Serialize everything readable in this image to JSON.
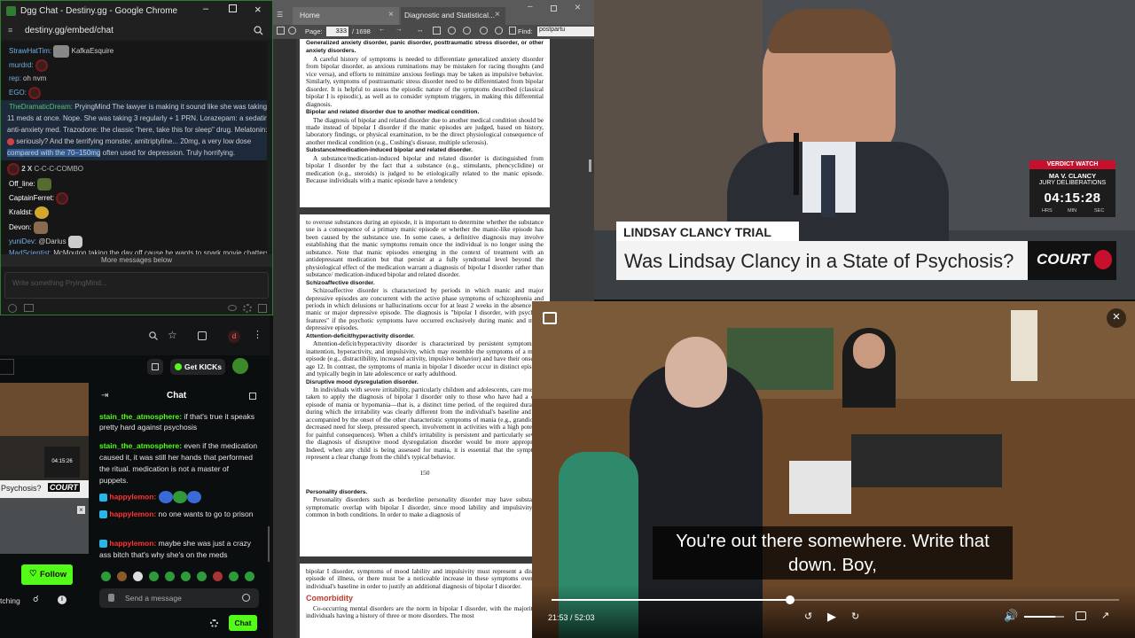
{
  "chrome": {
    "title": "Dgg Chat - Destiny.gg - Google Chrome",
    "url": "destiny.gg/embed/chat",
    "messages": [
      {
        "user": "StrawHatTim:",
        "text": "KafkaEsquire"
      },
      {
        "user": "murdrd:",
        "text": ""
      },
      {
        "user": "rep:",
        "text": "oh nvm"
      },
      {
        "user": "EGO:",
        "text": ""
      }
    ],
    "highlight": {
      "user": "TheDramaticDream:",
      "line1": "PryingMind The lawyer is making it sound like she was taking",
      "line2": "11 meds at once. Nope. She was taking 3 regularly + 1 PRN. Lorazepam: a sedating",
      "line3": "anti-anxiety med. Trazodone: the classic \"here, take this for sleep\" drug. Melatonin:",
      "line4": "seriously? And the terrifying monster, amitriptyline... 20mg, a very low dose",
      "line5a": "compared with the 70–150mg",
      "line5b": " often used for depression. Truly horrifying."
    },
    "combo": "2 X",
    "combo_text": "C-C-C-COMBO",
    "messages2": [
      {
        "user": "Off_line:",
        "text": ""
      },
      {
        "user": "CaptainFerret:",
        "text": ""
      },
      {
        "user": "Kraldst:",
        "text": ""
      },
      {
        "user": "Devon:",
        "text": ""
      },
      {
        "user": "yuniDev:",
        "text": "@Darius"
      },
      {
        "user": "MadScientist:",
        "text": "McMouton taking the day off cause he wants to spark movie chatters"
      }
    ],
    "more_below": "More messages below",
    "input_placeholder": "Write something PryingMind..."
  },
  "kick": {
    "avatar_letter": "d",
    "get_kicks": "Get KICKs",
    "chat_title": "Chat",
    "mini_time": "04:15:26",
    "mini_banner": "Psychosis?",
    "mini_logo": "COURT",
    "follow": "Follow",
    "watching": "tching",
    "messages": [
      {
        "user": "stain_the_atmosphere:",
        "text": " if that's true it speaks pretty hard against psychosis"
      },
      {
        "user": "stain_the_atmosphere:",
        "text": " even if the medication caused it, it was still her hands that performed the ritual. medication is not a master of puppets."
      },
      {
        "user": "happylemon:",
        "text": ""
      },
      {
        "user": "happylemon:",
        "text": " no one wants to go to prison"
      },
      {
        "user": "happylemon:",
        "text": " maybe she was just a crazy ass bitch that's why she's on the meds"
      }
    ],
    "send_placeholder": "Send a message",
    "chat_button": "Chat"
  },
  "pdf": {
    "tab_home": "Home",
    "tab_doc": "Diagnostic and Statistical...",
    "page_label": "Page:",
    "page_value": "333",
    "page_total": "/ 1698",
    "find_label": "Find:",
    "find_value": "postpartu",
    "p1": {
      "h0": "Generalized anxiety disorder, panic disorder, posttraumatic stress disorder, or other anxiety disorders.",
      "t0": "A careful history of symptoms is needed to differentiate generalized anxiety disorder from bipolar disorder, as anxious ruminations may be mistaken for racing thoughts (and vice versa), and efforts to minimize anxious feelings may be taken as impulsive behavior. Similarly, symptoms of posttraumatic stress disorder need to be differentiated from bipolar disorder. It is helpful to assess the episodic nature of the symptoms described (classical bipolar I is episodic), as well as to consider symptom triggers, in making this differential diagnosis.",
      "h1": "Bipolar and related disorder due to another medical condition.",
      "t1": "The diagnosis of bipolar and related disorder due to another medical condition should be made instead of bipolar I disorder if the manic episodes are judged, based on history, laboratory findings, or physical examination, to be the direct physiological consequence of another medical condition (e.g., Cushing's disease, multiple sclerosis).",
      "h2": "Substance/medication-induced bipolar and related disorder.",
      "t2": "A substance/medication-induced bipolar and related disorder is distinguished from bipolar I disorder by the fact that a substance (e.g., stimulants, phencyclidine) or medication (e.g., steroids) is judged to be etiologically related to the manic episode. Because individuals with a manic episode have a tendency"
    },
    "p2": {
      "t0": "to overuse substances during an episode, it is important to determine whether the substance use is a consequence of a primary manic episode or whether the manic-like episode has been caused by the substance use. In some cases, a definitive diagnosis may involve establishing that the manic symptoms remain once the individual is no longer using the substance. Note that manic episodes emerging in the context of treatment with an antidepressant medication but that persist at a fully syndromal level beyond the physiological effect of the medication warrant a diagnosis of bipolar I disorder rather than substance/ medication-induced bipolar and related disorder.",
      "h1": "Schizoaffective disorder.",
      "t1": "Schizoaffective disorder is characterized by periods in which manic and major depressive episodes are concurrent with the active phase symptoms of schizophrenia and periods in which delusions or hallucinations occur for at least 2 weeks in the absence of a manic or major depressive episode. The diagnosis is \"bipolar I disorder, with psychotic features\" if the psychotic symptoms have occurred exclusively during manic and major depressive episodes.",
      "h2": "Attention-deficit/hyperactivity disorder.",
      "t2": "Attention-deficit/hyperactivity disorder is characterized by persistent symptoms of inattention, hyperactivity, and impulsivity, which may resemble the symptoms of a manic episode (e.g., distractibility, increased activity, impulsive behavior) and have their onset by age 12. In contrast, the symptoms of mania in bipolar I disorder occur in distinct episodes and typically begin in late adolescence or early adulthood.",
      "h3": "Disruptive mood dysregulation disorder.",
      "t3": "In individuals with severe irritability, particularly children and adolescents, care must be taken to apply the diagnosis of bipolar I disorder only to those who have had a clear episode of mania or hypomania—that is, a distinct time period, of the required duration, during which the irritability was clearly different from the individual's baseline and was accompanied by the onset of the other characteristic symptoms of mania (e.g., grandiosity, decreased need for sleep, pressured speech, involvement in activities with a high potential for painful consequences). When a child's irritability is persistent and particularly severe, the diagnosis of disruptive mood dysregulation disorder would be more appropriate. Indeed, when any child is being assessed for mania, it is essential that the symptoms represent a clear change from the child's typical behavior.",
      "pagenum": "150",
      "h4": "Personality disorders.",
      "t4": "Personality disorders such as borderline personality disorder may have substantial symptomatic overlap with bipolar I disorder, since mood lability and impulsivity are common in both conditions. In order to make a diagnosis of"
    },
    "p3": {
      "t0": "bipolar I disorder, symptoms of mood lability and impulsivity must represent a distinct episode of illness, or there must be a noticeable increase in these symptoms over the individual's baseline in order to justify an additional diagnosis of bipolar I disorder.",
      "h1": "Comorbidity",
      "t1": "Co-occurring mental disorders are the norm in bipolar I disorder, with the majority of individuals having a history of three or more disorders. The most"
    }
  },
  "video1": {
    "badge": "VERDICT WATCH",
    "sub1": "MA V. CLANCY",
    "sub2": "JURY DELIBERATIONS",
    "clock": "04:15:28",
    "hrs": "HRS",
    "min": "MIN",
    "sec": "SEC",
    "lower_title": "LINDSAY CLANCY TRIAL",
    "headline": "Was Lindsay Clancy in a State of Psychosis?",
    "logo": "COURT"
  },
  "video2": {
    "caption_line1": "You're out there somewhere. Write that",
    "caption_line2": "down. Boy,",
    "time": "21:53 / 52:03",
    "progress": 0.421
  }
}
